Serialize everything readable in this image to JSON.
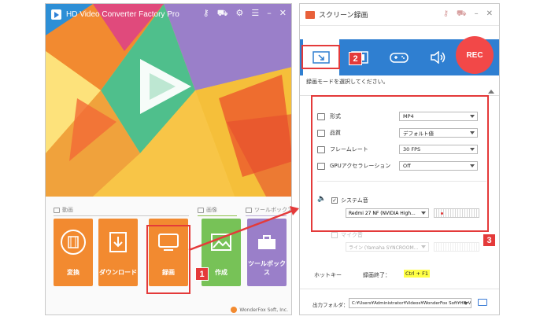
{
  "left_window": {
    "title": "HD Video Converter Factory Pro",
    "controls": [
      "key-icon",
      "cart-icon",
      "gear-icon",
      "menu-icon",
      "minimize-icon",
      "close-icon"
    ],
    "sections": [
      {
        "label": "動画"
      },
      {
        "label": "画像"
      },
      {
        "label": "ツールボックス"
      }
    ],
    "tiles": [
      {
        "label": "変換",
        "color": "#f28a30"
      },
      {
        "label": "ダウンロード",
        "color": "#f28a30"
      },
      {
        "label": "録画",
        "color": "#f28a30"
      },
      {
        "label": "作成",
        "color": "#77c257"
      },
      {
        "label": "ツールボックス",
        "color": "#9a7fc9"
      }
    ],
    "footer": "WonderFox Soft, Inc."
  },
  "right_window": {
    "title": "スクリーン録画",
    "rec_label": "REC",
    "hint": "録画モードを選択してください。",
    "settings": [
      {
        "label": "形式",
        "value": "MP4"
      },
      {
        "label": "品質",
        "value": "デフォルト値"
      },
      {
        "label": "フレームレート",
        "value": "30 FPS"
      },
      {
        "label": "GPUアクセラレーション",
        "value": "Off"
      }
    ],
    "audio": {
      "system_label": "システム音",
      "system_checked": "✓",
      "system_device": "Redmi 27 NF (NVIDIA High...",
      "mic_label": "マイク音",
      "mic_device": "ライン (Yamaha SYNCROOM..."
    },
    "hotkey_label": "ホットキー",
    "hotkey_stop_label": "録画終了：",
    "hotkey_stop_value": "Ctrl + F1",
    "output_label": "出力フォルダ：",
    "output_path": "C:¥Users¥Administrator¥Videos¥WonderFox Soft¥HD V"
  },
  "badges": [
    "1",
    "2",
    "3"
  ],
  "accent_colors": {
    "highlight": "#e43a3a",
    "blue": "#2f7fd1",
    "rec": "#f24848"
  }
}
